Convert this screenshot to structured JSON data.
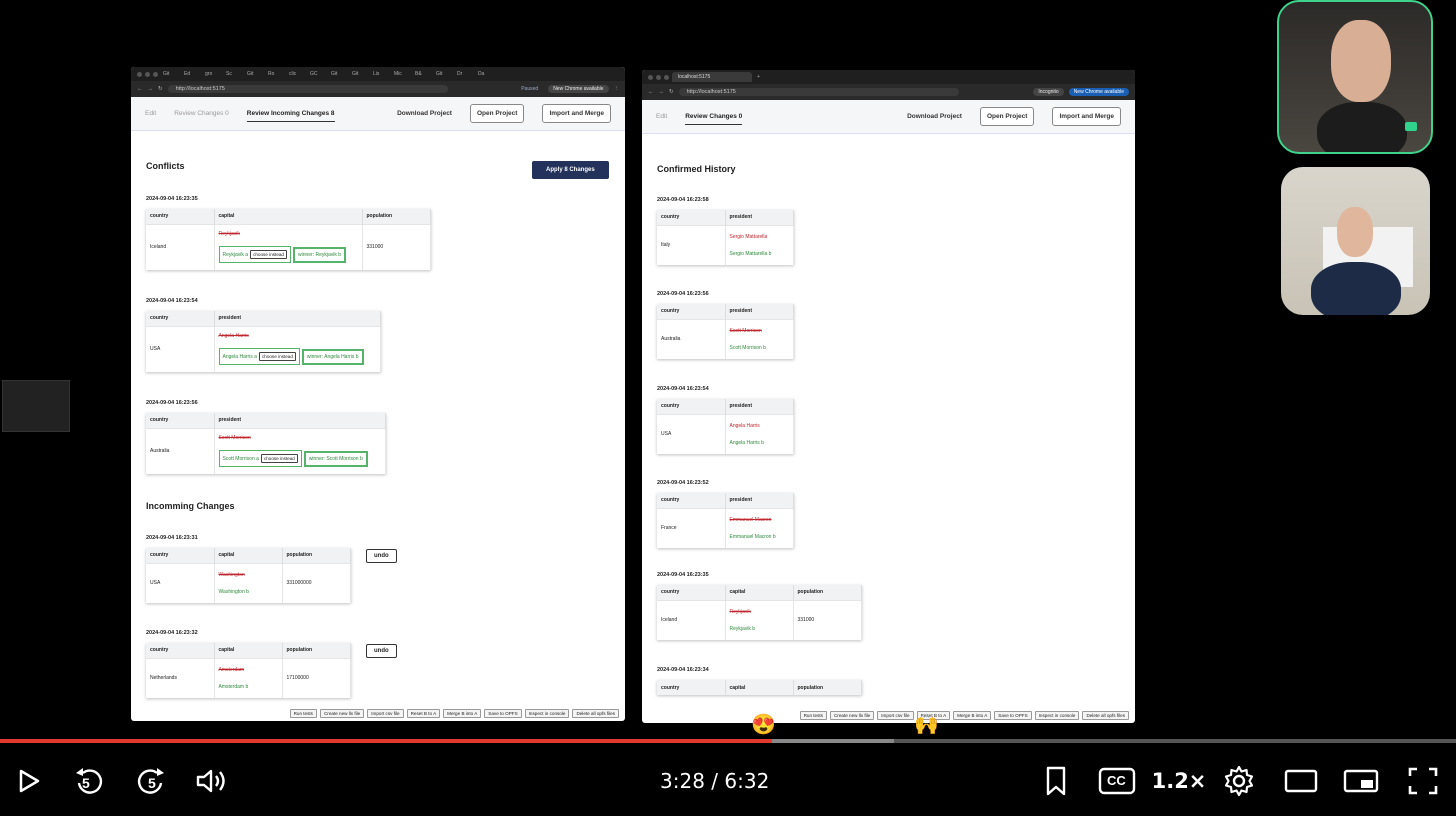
{
  "left_window": {
    "url": "http://localhost:5175",
    "tabs_short": [
      "Git",
      "Ed",
      "gro",
      "Sc",
      "Git",
      "Ro",
      "clic",
      "GC",
      "Git",
      "Git",
      "Lis",
      "Mic",
      "B&",
      "Git",
      "Dr",
      "Da"
    ],
    "profile": "Paused",
    "chrome_notice": "New Chrome available",
    "nav": {
      "edit": "Edit",
      "review_changes": "Review Changes 0",
      "review_incoming": "Review Incoming Changes 8",
      "download": "Download Project",
      "open": "Open Project",
      "import_merge": "Import and Merge"
    },
    "conflicts_title": "Conflicts",
    "apply_button": "Apply 8 Changes",
    "conflicts": [
      {
        "timestamp": "2024-09-04 16:23:35",
        "headers": [
          "country",
          "capital",
          "population"
        ],
        "country": "Iceland",
        "old": "Reykjavik",
        "option_a": "Reykjavik a",
        "choose": "choose instead",
        "winner": "winner: Reykjavik b",
        "population": "331000"
      },
      {
        "timestamp": "2024-09-04 16:23:54",
        "headers": [
          "country",
          "president"
        ],
        "country": "USA",
        "old": "Angela Harris",
        "option_a": "Angela Harris a",
        "choose": "choose instead",
        "winner": "winner: Angela Harris b"
      },
      {
        "timestamp": "2024-09-04 16:23:56",
        "headers": [
          "country",
          "president"
        ],
        "country": "Australia",
        "old": "Scott Morrison",
        "option_a": "Scott Morrison a",
        "choose": "choose instead",
        "winner": "winner: Scott Morrison b"
      }
    ],
    "incoming_title": "Incomming Changes",
    "incoming": [
      {
        "timestamp": "2024-09-04 16:23:31",
        "headers": [
          "country",
          "capital",
          "population"
        ],
        "country": "USA",
        "old": "Washington",
        "new": "Washington b",
        "population": "331000000",
        "undo": "undo"
      },
      {
        "timestamp": "2024-09-04 16:23:32",
        "headers": [
          "country",
          "capital",
          "population"
        ],
        "country": "Netherlands",
        "old": "Amsterdam",
        "new": "Amsterdam b",
        "population": "17100000",
        "undo": "undo"
      }
    ],
    "footer_buttons": [
      "Run tests",
      "Create new llx file",
      "Import csv file",
      "Reset B to A",
      "Merge B into A",
      "Save to OPFS",
      "Inspect in console",
      "Delete all opfs files"
    ]
  },
  "right_window": {
    "tab_title": "localhost:5175",
    "url": "http://localhost:5175",
    "profile": "Incognito",
    "chrome_notice": "New Chrome available",
    "nav": {
      "edit": "Edit",
      "review_changes": "Review Changes 0",
      "download": "Download Project",
      "open": "Open Project",
      "import_merge": "Import and Merge"
    },
    "history_title": "Confirmed History",
    "history": [
      {
        "timestamp": "2024-09-04 16:23:58",
        "headers": [
          "country",
          "president"
        ],
        "country": "Italy",
        "old": "Sergio Mattarella",
        "new": "Sergio Mattarella b"
      },
      {
        "timestamp": "2024-09-04 16:23:56",
        "headers": [
          "country",
          "president"
        ],
        "country": "Australia",
        "old": "Scott Morrison",
        "new": "Scott Morrison b"
      },
      {
        "timestamp": "2024-09-04 16:23:54",
        "headers": [
          "country",
          "president"
        ],
        "country": "USA",
        "old": "Angela Harris",
        "new": "Angela Harris b"
      },
      {
        "timestamp": "2024-09-04 16:23:52",
        "headers": [
          "country",
          "president"
        ],
        "country": "France",
        "old": "Emmanuel Macron",
        "new": "Emmanuel Macron b"
      },
      {
        "timestamp": "2024-09-04 16:23:35",
        "headers": [
          "country",
          "capital",
          "population"
        ],
        "country": "Iceland",
        "old": "Reykjavik",
        "new": "Reykjavik b",
        "population": "331000"
      },
      {
        "timestamp": "2024-09-04 16:23:34",
        "headers": [
          "country",
          "capital",
          "population"
        ]
      }
    ],
    "footer_buttons": [
      "Run tests",
      "Create new llx file",
      "Import csv file",
      "Reset B to A",
      "Merge B into A",
      "Save to OPFS",
      "Inspect in console",
      "Delete all opfs files"
    ]
  },
  "player": {
    "time_current": "3:28",
    "time_separator": "/",
    "time_total": "6:32",
    "progress_fraction": 0.53,
    "buffered_fraction": 0.614,
    "rewind_seconds": "5",
    "forward_seconds": "5",
    "speed": "1.2×",
    "cc": "CC",
    "reaction_1": "😍",
    "reaction_2": "🙌",
    "accent_color": "#e03a2f"
  }
}
